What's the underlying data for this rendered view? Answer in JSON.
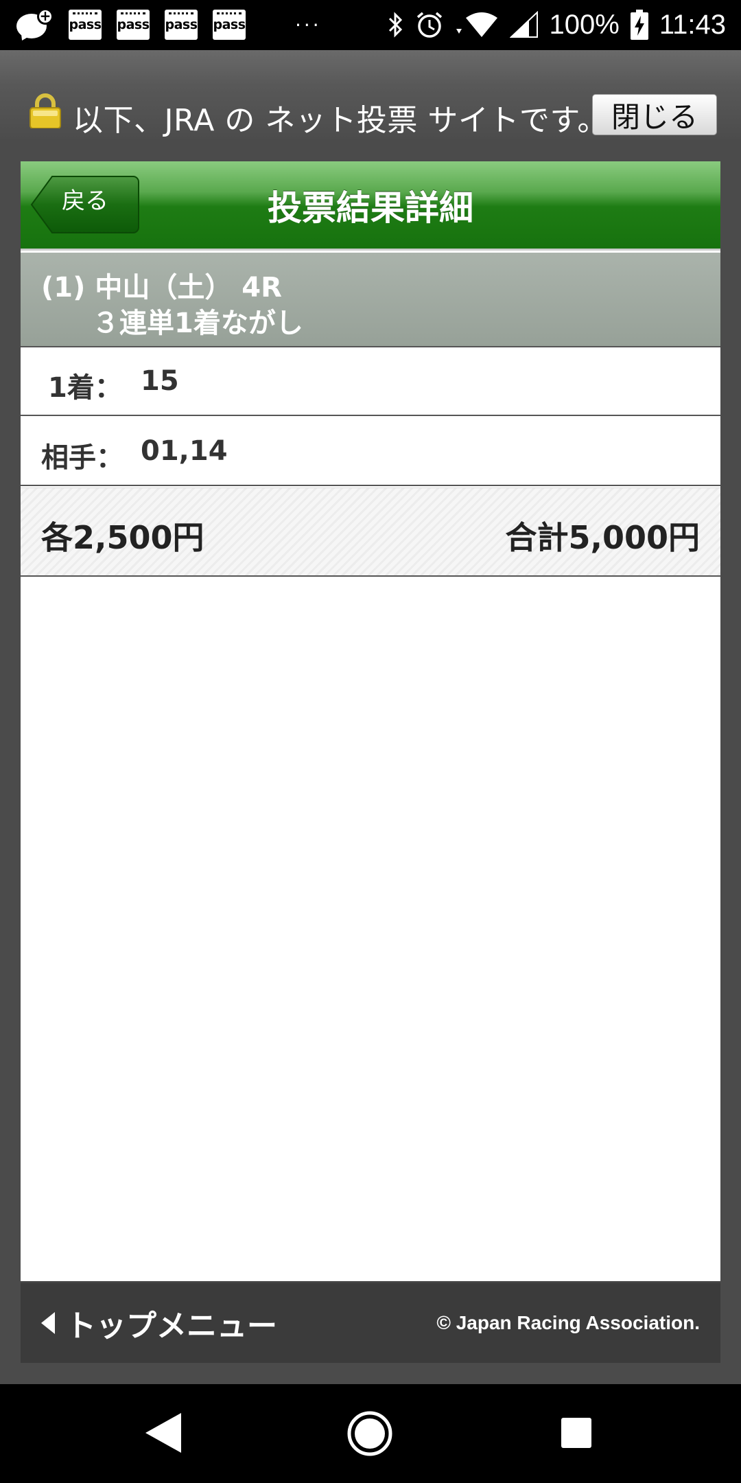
{
  "status_bar": {
    "pass_icons": [
      "pass",
      "pass",
      "pass",
      "pass"
    ],
    "more": "···",
    "battery": "100%",
    "time": "11:43"
  },
  "banner": {
    "text": "以下、JRA の ネット投票 サイトです。",
    "close_label": "閉じる"
  },
  "header": {
    "back_label": "戻る",
    "title": "投票結果詳細"
  },
  "race": {
    "line1": "(1) 中山（土） 4R",
    "line2": "３連単1着ながし"
  },
  "rows": {
    "first_label": "1着：",
    "first_value": "15",
    "partner_label": "相手：",
    "partner_value": "01,14"
  },
  "amount": {
    "each": "各2,500円",
    "total": "合計5,000円"
  },
  "footer": {
    "top_menu": "トップメニュー",
    "copyright": "© Japan Racing Association."
  },
  "colors": {
    "header_green": "#1e7c14",
    "race_bar_gray": "#9aa49b"
  }
}
